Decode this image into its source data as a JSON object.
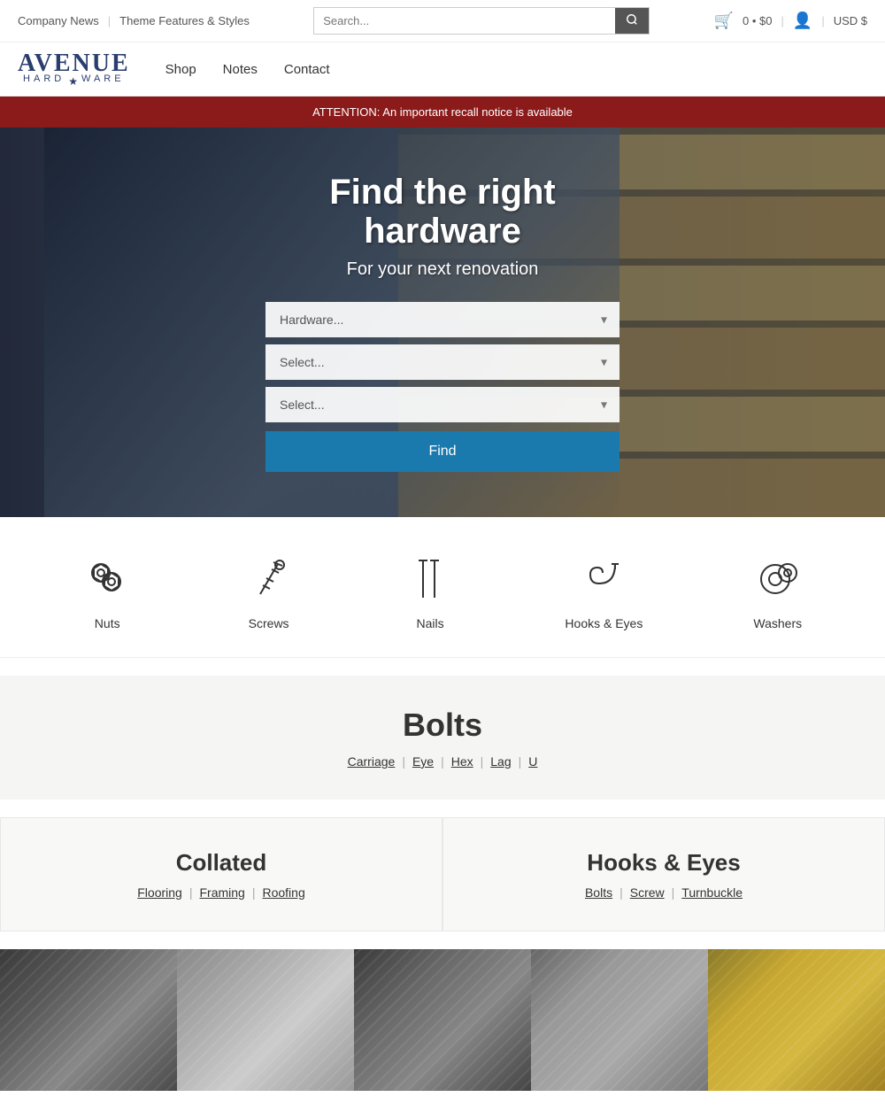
{
  "topbar": {
    "link1": "Company News",
    "sep1": "|",
    "link2": "Theme Features & Styles",
    "search_placeholder": "Search...",
    "cart": "0 • $0",
    "currency": "USD $"
  },
  "nav": {
    "logo_avenue": "AVENUE",
    "logo_hard": "HARD",
    "logo_ware": "WARE",
    "shop": "Shop",
    "notes": "Notes",
    "contact": "Contact"
  },
  "alert": {
    "message": "ATTENTION: An important recall notice is available"
  },
  "hero": {
    "title": "Find the right hardware",
    "subtitle": "For your next renovation",
    "dropdown1": "Hardware...",
    "dropdown2": "Select...",
    "dropdown3": "Select...",
    "find_btn": "Find"
  },
  "categories": [
    {
      "label": "Nuts",
      "icon": "nuts-icon"
    },
    {
      "label": "Screws",
      "icon": "screws-icon"
    },
    {
      "label": "Nails",
      "icon": "nails-icon"
    },
    {
      "label": "Hooks & Eyes",
      "icon": "hooks-icon"
    },
    {
      "label": "Washers",
      "icon": "washers-icon"
    }
  ],
  "bolts": {
    "title": "Bolts",
    "links": [
      "Carriage",
      "Eye",
      "Hex",
      "Lag",
      "U"
    ]
  },
  "collated": {
    "title": "Collated",
    "links": [
      "Flooring",
      "Framing",
      "Roofing"
    ]
  },
  "hooks_eyes": {
    "title": "Hooks & Eyes",
    "links": [
      "Bolts",
      "Screw",
      "Turnbuckle"
    ]
  },
  "products": [
    {
      "type": "dark-screws"
    },
    {
      "type": "silver-screws"
    },
    {
      "type": "black-screws"
    },
    {
      "type": "steel-screws"
    },
    {
      "type": "gold-screws"
    }
  ]
}
